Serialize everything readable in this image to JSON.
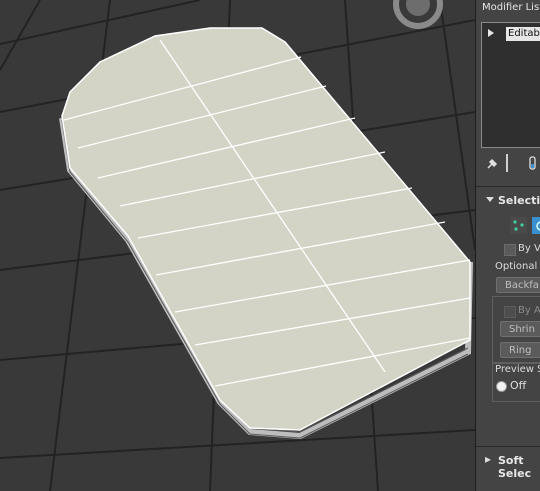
{
  "viewport": {
    "background": "#3a3a3a",
    "grid_color": "#262626",
    "mesh_fill": "#d3d4c6",
    "mesh_edge": "#ffffff"
  },
  "panel": {
    "modifier_list_label": "Modifier List",
    "stack_item": "Editable",
    "selection_title": "Selection",
    "by_vertex": "By Ve",
    "optional_label": "Optional C",
    "backface_button": "Backfa",
    "by_angle": "By An",
    "shrink_button": "Shrin",
    "ring_button": "Ring",
    "preview_label": "Preview S",
    "off_label": "Off",
    "soft_selection_title": "Soft Selec",
    "accent": "#3a8fd0"
  }
}
